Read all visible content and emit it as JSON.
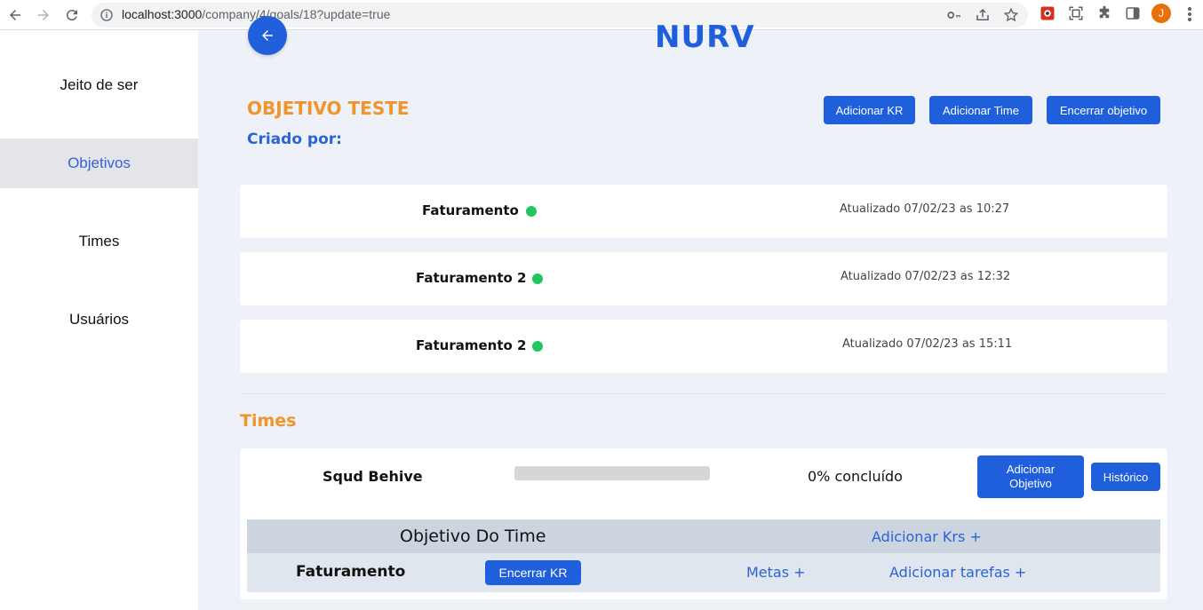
{
  "browser": {
    "url_host": "localhost:3000",
    "url_path": "/company/4/goals/18?update=true",
    "avatar_letter": "J"
  },
  "sidebar": {
    "items": [
      {
        "label": "Jeito de ser"
      },
      {
        "label": "Objetivos"
      },
      {
        "label": "Times"
      },
      {
        "label": "Usuários"
      }
    ]
  },
  "header": {
    "brand": "NURV",
    "objective_title": "OBJETIVO TESTE",
    "created_by_label": "Criado por:"
  },
  "actions": {
    "add_kr": "Adicionar KR",
    "add_team": "Adicionar Time",
    "close_objective": "Encerrar objetivo"
  },
  "key_results": [
    {
      "name": "Faturamento",
      "status_color": "#22c55e",
      "updated": "Atualizado 07/02/23 as 10:27"
    },
    {
      "name": "Faturamento 2",
      "status_color": "#22c55e",
      "updated": "Atualizado 07/02/23 as 12:32"
    },
    {
      "name": "Faturamento 2",
      "status_color": "#22c55e",
      "updated": "Atualizado 07/02/23 as 15:11"
    }
  ],
  "teams_section": {
    "heading": "Times",
    "team": {
      "name": "Squd Behive",
      "progress_fraction": 0,
      "progress_text": "0% concluído",
      "add_objective_label": "Adicionar Objetivo",
      "history_label": "Histórico"
    },
    "team_objectives": {
      "header_title": "Objetivo Do Time",
      "add_krs_label": "Adicionar Krs +",
      "rows": [
        {
          "name": "Faturamento",
          "close_kr_label": "Encerrar KR",
          "goals_label": "Metas +",
          "add_tasks_label": "Adicionar tarefas +"
        }
      ]
    }
  },
  "colors": {
    "accent_blue": "#1f5fdc",
    "accent_orange": "#f0952b",
    "status_green": "#22c55e"
  }
}
